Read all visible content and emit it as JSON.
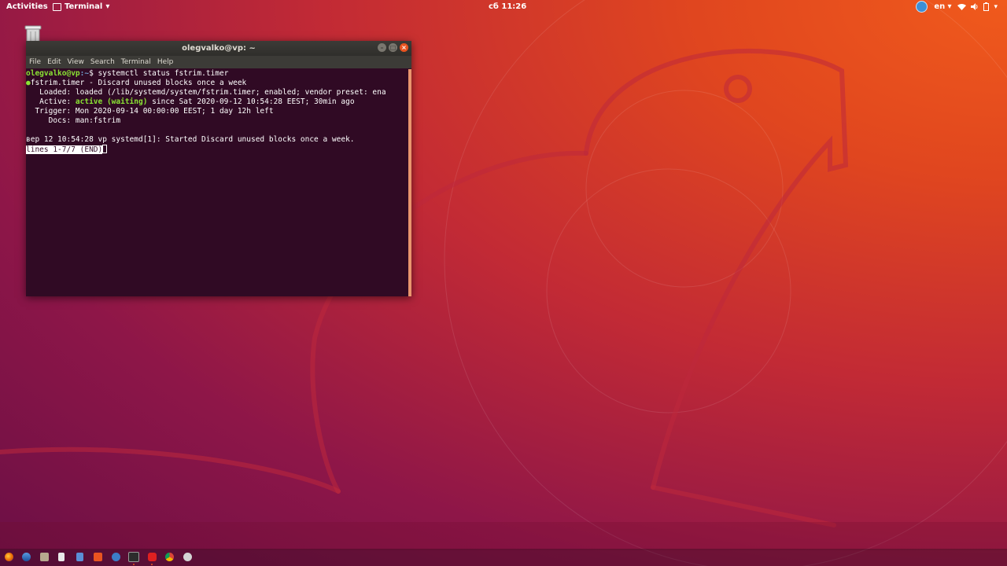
{
  "topbar": {
    "activities": "Activities",
    "app_menu": "Terminal",
    "clock": "сб 11:26",
    "language": "en"
  },
  "window": {
    "title": "olegvalko@vp: ~",
    "menus": [
      "File",
      "Edit",
      "View",
      "Search",
      "Terminal",
      "Help"
    ]
  },
  "terminal": {
    "prompt_user": "olegvalko@vp",
    "prompt_path": ":~",
    "prompt_symbol": "$ ",
    "command": "systemctl status fstrim.timer",
    "status_dot": "●",
    "line_unit": "fstrim.timer - Discard unused blocks once a week",
    "line_loaded": "   Loaded: loaded (/lib/systemd/system/fstrim.timer; enabled; vendor preset: ena",
    "line_active_label": "   Active: ",
    "line_active_state": "active (waiting)",
    "line_active_rest": " since Sat 2020-09-12 10:54:28 EEST; 30min ago",
    "line_trigger": "  Trigger: Mon 2020-09-14 00:00:00 EEST; 1 day 12h left",
    "line_docs": "     Docs: man:fstrim",
    "line_log": "вер 12 10:54:28 vp systemd[1]: Started Discard unused blocks once a week.",
    "pager_status": "lines 1-7/7 (END)"
  },
  "colors": {
    "accent": "#e95420",
    "terminal_bg": "#300a24",
    "prompt_green": "#8ae234"
  },
  "dock": {
    "icons": [
      "firefox-icon",
      "thunderbird-icon",
      "files-icon",
      "libreoffice-icon",
      "document-icon",
      "software-center-icon",
      "help-icon",
      "terminal-icon",
      "anydesk-icon",
      "chrome-icon",
      "settings-icon"
    ]
  },
  "desktop": {
    "icons": [
      "trash-icon"
    ]
  }
}
